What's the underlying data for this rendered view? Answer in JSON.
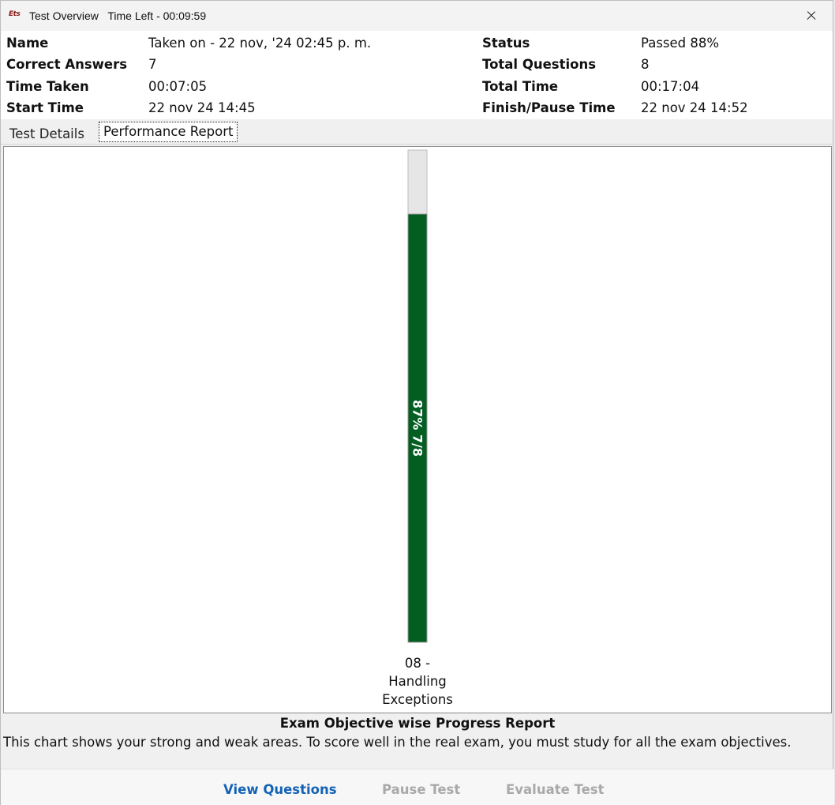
{
  "window": {
    "app_icon_text": "Ets",
    "title": "Test Overview",
    "time_left": "Time Left - 00:09:59"
  },
  "info": {
    "name_label": "Name",
    "name_value": "Taken on - 22 nov, '24 02:45 p. m.",
    "correct_label": "Correct Answers",
    "correct_value": "7",
    "time_taken_label": "Time Taken",
    "time_taken_value": "00:07:05",
    "start_label": "Start Time",
    "start_value": "22 nov 24 14:45",
    "status_label": "Status",
    "status_value": "Passed 88%",
    "total_q_label": "Total Questions",
    "total_q_value": "8",
    "total_time_label": "Total Time",
    "total_time_value": "00:17:04",
    "finish_label": "Finish/Pause Time",
    "finish_value": "22 nov 24 14:52"
  },
  "tabs": {
    "test_details": "Test Details",
    "performance_report": "Performance Report"
  },
  "chart_data": {
    "type": "bar",
    "categories": [
      "08 - Handling Exceptions"
    ],
    "category_label_lines": [
      [
        "08 -",
        "Handling",
        "Exceptions"
      ]
    ],
    "values": [
      87
    ],
    "bar_labels": [
      "87% 7/8"
    ],
    "ylim": [
      0,
      100
    ],
    "colors": {
      "fill": "#035e22",
      "remainder": "#e6e6e6"
    },
    "grid": false
  },
  "footer": {
    "title": "Exam Objective wise Progress Report",
    "description": "This chart shows your strong and weak areas. To score well in the real exam, you must study for all the exam objectives."
  },
  "buttons": {
    "view_questions": "View Questions",
    "pause_test": "Pause Test",
    "evaluate_test": "Evaluate Test"
  },
  "colors": {
    "link_blue": "#1462b5",
    "disabled_gray": "#a9a9a9"
  }
}
